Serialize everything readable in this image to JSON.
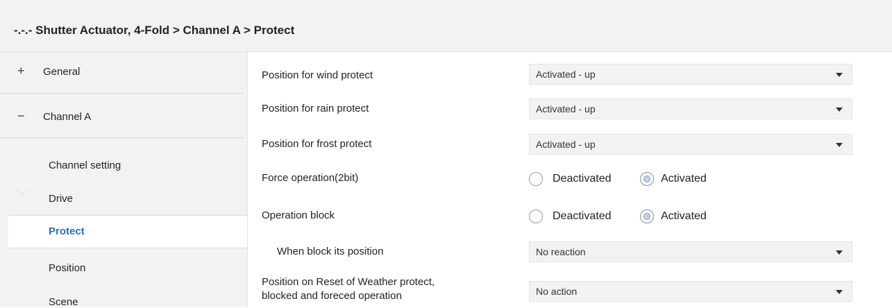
{
  "header": {
    "breadcrumb": "-.-.- Shutter Actuator, 4-Fold > Channel A > Protect"
  },
  "sidebar": {
    "general": {
      "sign": "+",
      "label": "General"
    },
    "channel": {
      "sign": "−",
      "label": "Channel A"
    },
    "sub_items": [
      "Channel setting",
      "Drive",
      "Protect",
      "Position",
      "Scene"
    ],
    "active_item": "Protect"
  },
  "params": {
    "wind": {
      "label": "Position for wind  protect",
      "value": "Activated - up"
    },
    "rain": {
      "label": "Position for rain  protect",
      "value": "Activated - up"
    },
    "frost": {
      "label": "Position for frost  protect",
      "value": "Activated - up"
    },
    "force": {
      "label": "Force operation(2bit)",
      "options": [
        "Deactivated",
        "Activated"
      ],
      "selected": "Activated"
    },
    "block": {
      "label": "Operation block",
      "options": [
        "Deactivated",
        "Activated"
      ],
      "selected": "Activated"
    },
    "block_pos": {
      "label": "When block its position",
      "value": "No reaction"
    },
    "reset": {
      "label_line1": "Position on Reset of Weather protect,",
      "label_line2": "blocked and foreced operation",
      "value": "No action"
    }
  },
  "colors": {
    "active_nav": "#2e6db2",
    "panel_bg": "#f2f2f2"
  }
}
